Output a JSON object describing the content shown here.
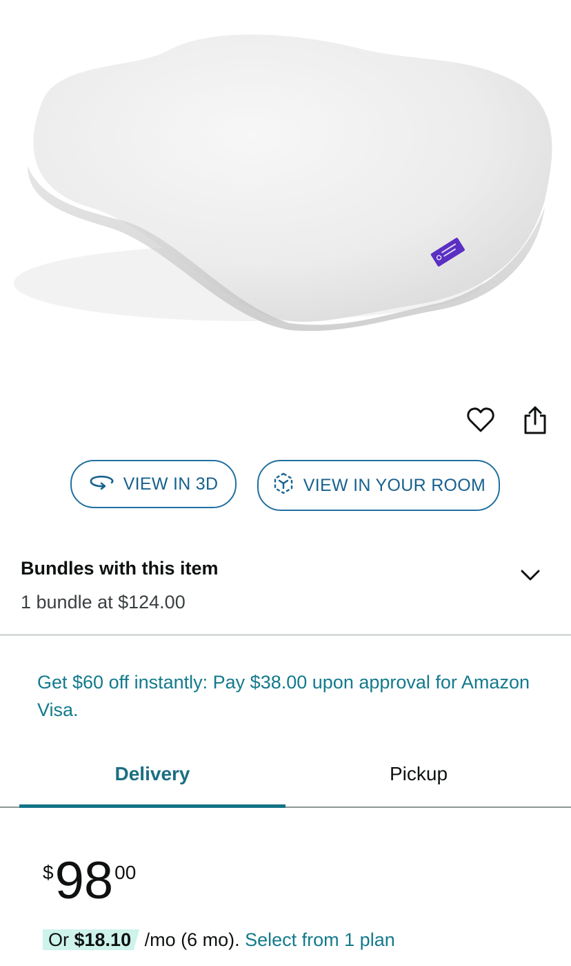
{
  "product_image": {
    "alt": "white contoured pillow"
  },
  "actions": {
    "wishlist_icon": "heart-outline-icon",
    "share_icon": "share-icon"
  },
  "view_buttons": {
    "view_3d_label": "VIEW IN 3D",
    "view_room_label": "VIEW IN YOUR ROOM"
  },
  "bundles": {
    "title": "Bundles with this item",
    "subtitle": "1 bundle at $124.00"
  },
  "promo": {
    "text": "Get $60 off instantly: Pay $38.00 upon approval for Amazon Visa."
  },
  "tabs": [
    {
      "label": "Delivery",
      "active": true
    },
    {
      "label": "Pickup",
      "active": false
    }
  ],
  "price": {
    "symbol": "$",
    "whole": "98",
    "fraction": "00"
  },
  "installment": {
    "prefix": "Or ",
    "amount": "$18.10",
    "middle": " /mo (6 mo). ",
    "link": "Select from 1 plan"
  },
  "colors": {
    "accent": "#137a8c",
    "button_border": "#1f6f9f",
    "highlight": "#cdf3ea",
    "pillow_tag": "#5a2fc2"
  }
}
